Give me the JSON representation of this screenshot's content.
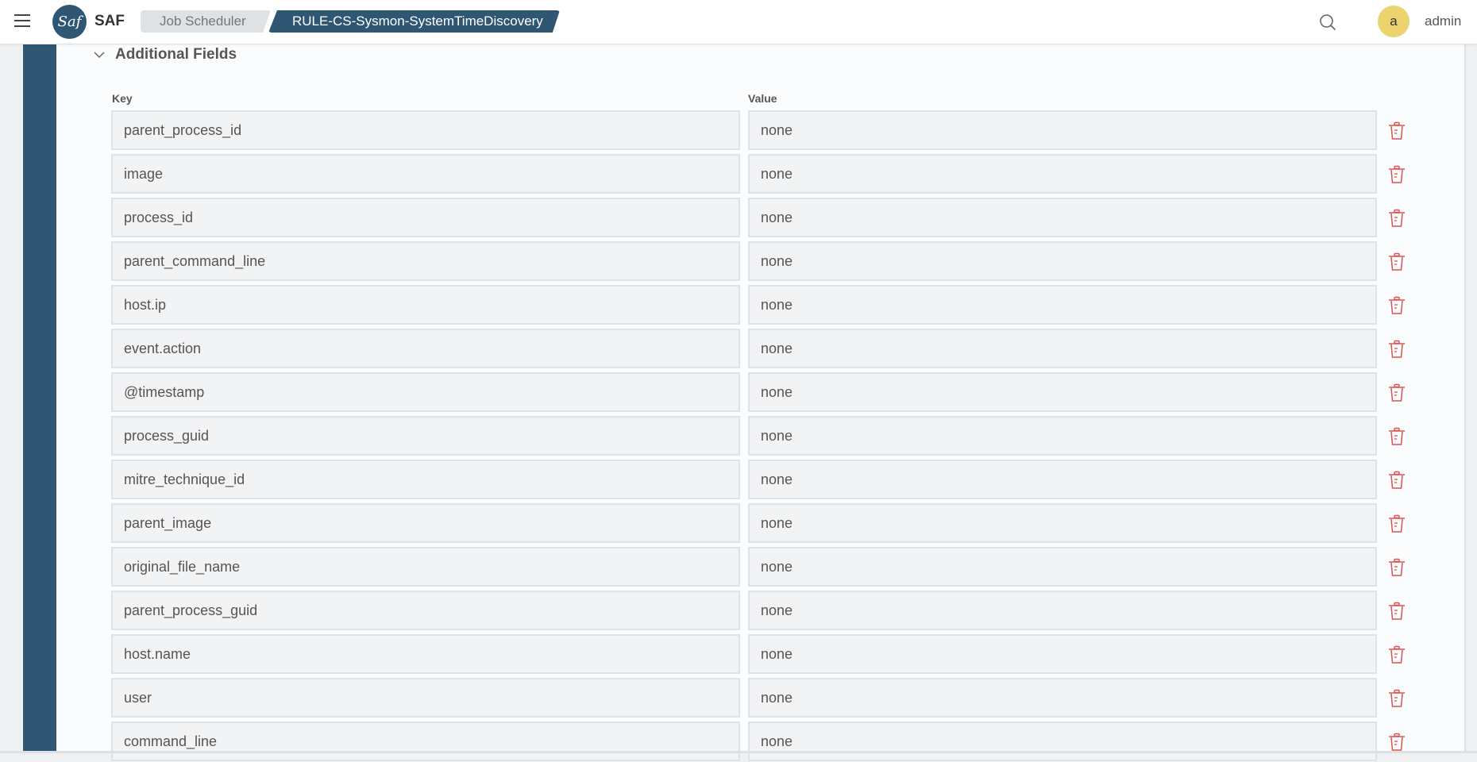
{
  "header": {
    "logo_text": "Saf",
    "brand": "SAF",
    "breadcrumb": [
      "Job Scheduler",
      "RULE-CS-Sysmon-SystemTimeDiscovery"
    ],
    "avatar_initial": "a",
    "username": "admin"
  },
  "section": {
    "title": "Additional Fields",
    "key_label": "Key",
    "value_label": "Value"
  },
  "fields": [
    {
      "key": "parent_process_id",
      "value": "none"
    },
    {
      "key": "image",
      "value": "none"
    },
    {
      "key": "process_id",
      "value": "none"
    },
    {
      "key": "parent_command_line",
      "value": "none"
    },
    {
      "key": "host.ip",
      "value": "none"
    },
    {
      "key": "event.action",
      "value": "none"
    },
    {
      "key": "@timestamp",
      "value": "none"
    },
    {
      "key": "process_guid",
      "value": "none"
    },
    {
      "key": "mitre_technique_id",
      "value": "none"
    },
    {
      "key": "parent_image",
      "value": "none"
    },
    {
      "key": "original_file_name",
      "value": "none"
    },
    {
      "key": "parent_process_guid",
      "value": "none"
    },
    {
      "key": "host.name",
      "value": "none"
    },
    {
      "key": "user",
      "value": "none"
    },
    {
      "key": "command_line",
      "value": "none"
    }
  ],
  "colors": {
    "brand": "#2f5673",
    "delete": "#d9534f",
    "avatar": "#ecd36d"
  }
}
